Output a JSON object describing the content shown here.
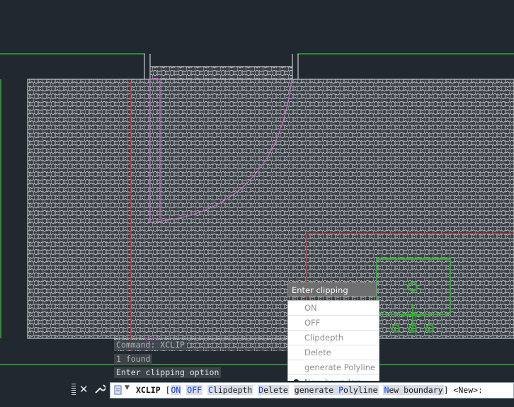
{
  "command_history": [
    "Command: XCLIP",
    "1 found",
    "Enter clipping option"
  ],
  "tooltip": "Enter clipping option",
  "menu": {
    "items": [
      "ON",
      "OFF",
      "Clipdepth",
      "Delete",
      "generate Polyline",
      "New boundary"
    ],
    "selected_index": 5
  },
  "command_line": {
    "command": "XCLIP",
    "open_bracket": "[",
    "options": [
      {
        "hotkey": "ON",
        "rest": ""
      },
      {
        "hotkey": "OFF",
        "rest": ""
      },
      {
        "hotkey": "C",
        "rest": "lipdepth"
      },
      {
        "hotkey": "D",
        "rest": "elete"
      },
      {
        "hotkey": "",
        "rest": "generate ",
        "hotkey2": "P",
        "rest2": "olyline"
      },
      {
        "hotkey": "N",
        "rest": "ew boundary"
      }
    ],
    "close_bracket": "]",
    "default": "<New>:"
  },
  "icons": {
    "close": "close-icon",
    "customize": "wrench-icon",
    "prompt": "command-prompt-icon",
    "dropdown": "chevron-down-icon"
  },
  "colors": {
    "background": "#212830",
    "hatch_fill": "#3b4147",
    "hatch_line": "#d0d3d6",
    "green_lines": "#2fae2f",
    "red_lines": "#c83232",
    "pink_lines": "#c86cc8",
    "keyword_blue": "#1a3fd0"
  }
}
